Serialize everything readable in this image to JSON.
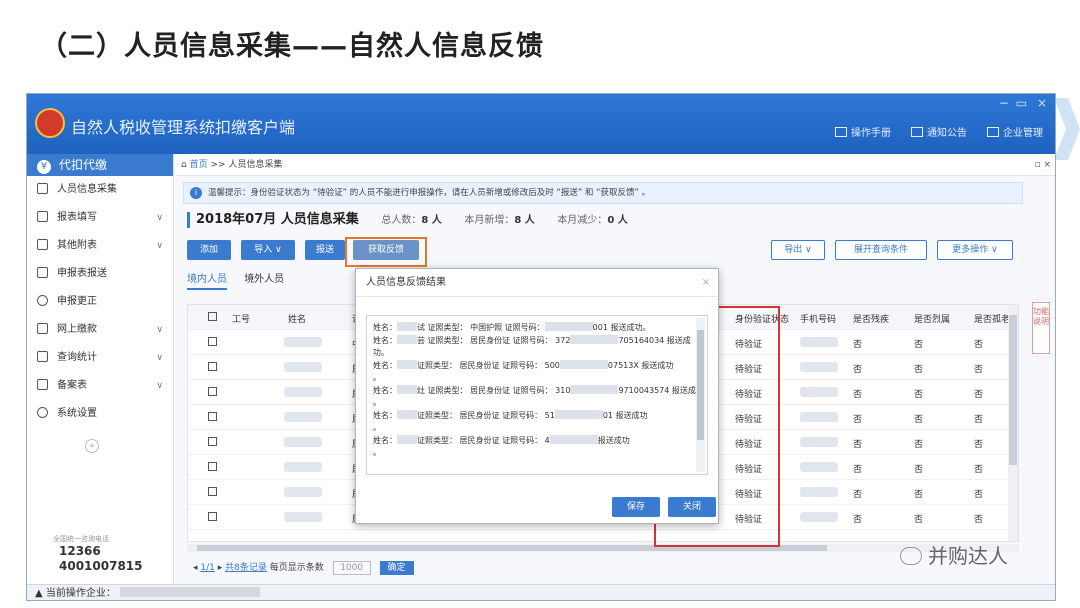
{
  "slide_title": "（二）人员信息采集——自然人信息反馈",
  "app": {
    "title": "自然人税收管理系统扣缴客户端",
    "window_controls": [
      "−",
      "▭",
      "×"
    ],
    "top_links": [
      "操作手册",
      "通知公告",
      "企业管理"
    ]
  },
  "sidebar": {
    "header": "代扣代缴",
    "items": [
      {
        "label": "人员信息采集",
        "caret": ""
      },
      {
        "label": "报表填写",
        "caret": "∨"
      },
      {
        "label": "其他附表",
        "caret": "∨"
      },
      {
        "label": "申报表报送",
        "caret": ""
      },
      {
        "label": "申报更正",
        "caret": ""
      },
      {
        "label": "网上缴款",
        "caret": "∨"
      },
      {
        "label": "查询统计",
        "caret": "∨"
      },
      {
        "label": "备案表",
        "caret": "∨"
      },
      {
        "label": "系统设置",
        "caret": ""
      }
    ],
    "collapse": "«",
    "hotline_caption": "全国统一咨询电话",
    "hotline_1": "12366",
    "hotline_2": "4001007815"
  },
  "statusbar": {
    "label": "当前操作企业："
  },
  "breadcrumb": {
    "home": "首页",
    "sep": ">>",
    "page": "人员信息采集",
    "controls": "▫ ×"
  },
  "notice": {
    "text": "温馨提示：身份验证状态为 “待验证” 的人员不能进行申报操作，请在人员新增或修改后及时 “报送” 和 “获取反馈” 。"
  },
  "stats": {
    "period": "2018年07月  人员信息采集",
    "total_label": "总人数：",
    "total": "8 人",
    "new_label": "本月新增：",
    "new": "8 人",
    "dec_label": "本月减少：",
    "dec": "0 人"
  },
  "toolbar": {
    "add": "添加",
    "import": "导入  ∨",
    "submit": "报送",
    "feedback": "获取反馈",
    "export": "导出  ∨",
    "expand": "展开查询条件",
    "more": "更多操作  ∨"
  },
  "tabs": [
    "境内人员",
    "境外人员"
  ],
  "table": {
    "headers": [
      "工号",
      "姓名",
      "证照",
      "身份验证状态",
      "手机号码",
      "是否残疾",
      "是否烈属",
      "是否孤老"
    ],
    "row_type_1": "中国",
    "row_type": "居民",
    "status": "待验证",
    "flag": "否"
  },
  "pager": {
    "page": "1/1",
    "total": "共8条记录",
    "size_label": "每页显示条数",
    "size": "1000",
    "ok": "确定"
  },
  "right_tab": "功能说明",
  "dialog": {
    "title": "人员信息反馈结果",
    "close": "×",
    "lines": [
      [
        "姓名：",
        "试  证照类型：  中国护照  证照号码：",
        "001  报送成功。"
      ],
      [
        "姓名：",
        "芸  证照类型：  居民身份证  证照号码：  372",
        "705164034  报送成"
      ],
      [
        "功。",
        "",
        ""
      ],
      [
        "姓名：",
        "证照类型：  居民身份证  证照号码：  500",
        "07513X  报送成功"
      ],
      [
        "。",
        "",
        ""
      ],
      [
        "姓名：",
        "灶  证照类型：  居民身份证  证照号码：  310",
        "9710043574  报送成功"
      ],
      [
        "。",
        "",
        ""
      ],
      [
        "姓名：",
        "证照类型：  居民身份证  证照号码：  51",
        "01  报送成功"
      ],
      [
        "。",
        "",
        ""
      ],
      [
        "姓名：",
        "证照类型：  居民身份证  证照号码：  4",
        "报送成功"
      ],
      [
        "。",
        "",
        ""
      ]
    ],
    "save": "保存",
    "close_btn": "关闭"
  },
  "watermark": "并购达人"
}
